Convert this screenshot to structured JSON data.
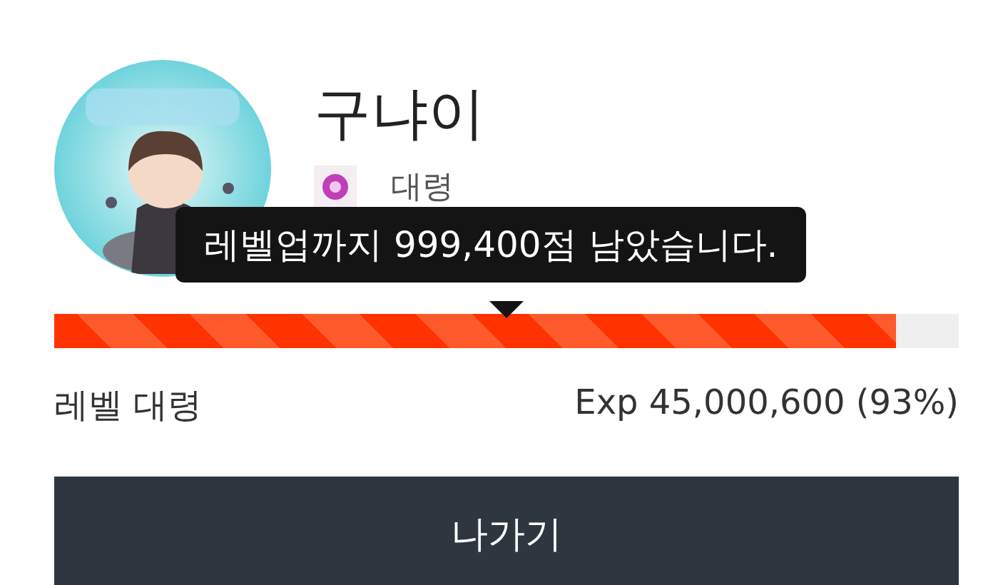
{
  "profile": {
    "name": "구냐이",
    "rank": "대령"
  },
  "tooltip": {
    "text": "레벨업까지 999,400점 남았습니다."
  },
  "progress": {
    "level": 0.93
  },
  "level_label": "레벨 대령",
  "exp_text": "Exp 45,000,600 (93%)",
  "buttons": [
    "나가기"
  ]
}
